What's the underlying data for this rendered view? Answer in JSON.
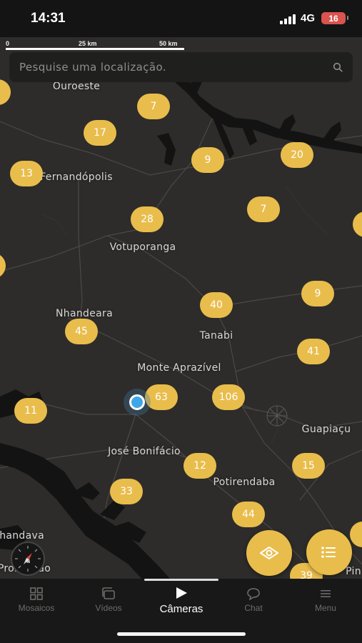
{
  "status_bar": {
    "time": "14:31",
    "network": "4G",
    "battery": "16"
  },
  "scale": {
    "labels": [
      "0",
      "25 km",
      "50 km"
    ]
  },
  "search": {
    "placeholder": "Pesquise uma localização."
  },
  "map": {
    "places": [
      "Ouroeste",
      "Fernandópolis",
      "Votuporanga",
      "Nhandeara",
      "Tanabi",
      "Monte Aprazível",
      "José Bonifácio",
      "Potirendaba",
      "Guapiaçu",
      "nhandava",
      "Promissão",
      "Pin"
    ],
    "clusters": [
      "7",
      "17",
      "9",
      "20",
      "13",
      "28",
      "7",
      "40",
      "9",
      "45",
      "41",
      "63",
      "106",
      "11",
      "12",
      "15",
      "33",
      "44",
      "39"
    ]
  },
  "colors": {
    "accent": "#e9bd4c",
    "user_location": "#3fa7e8",
    "background": "#2d2c2a"
  },
  "nav": {
    "items": [
      {
        "label": "Mosaicos",
        "icon": "grid-icon"
      },
      {
        "label": "Vídeos",
        "icon": "video-stack-icon"
      },
      {
        "label": "Câmeras",
        "icon": "play-icon"
      },
      {
        "label": "Chat",
        "icon": "chat-bubble-icon"
      },
      {
        "label": "Menu",
        "icon": "hamburger-icon"
      }
    ],
    "active": "Câmeras"
  }
}
